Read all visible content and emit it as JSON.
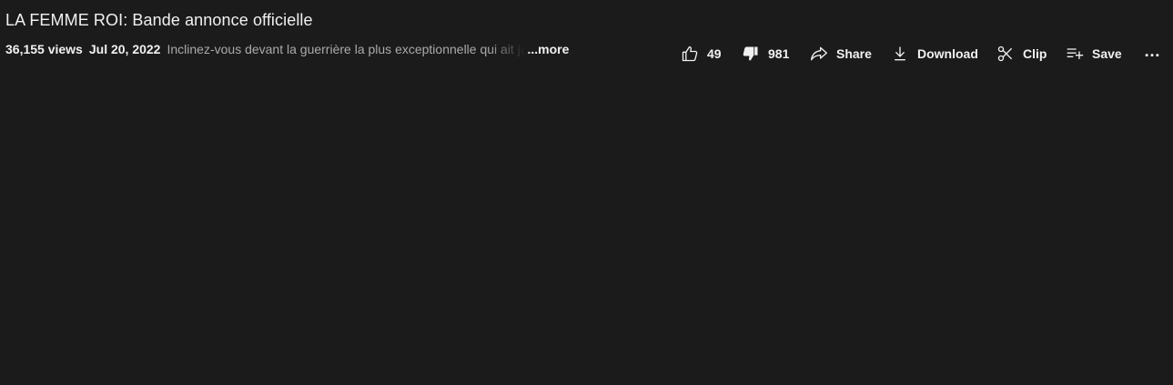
{
  "video": {
    "title": "LA FEMME ROI: Bande annonce officielle",
    "views": "36,155 views",
    "date": "Jul 20, 2022",
    "description_snippet": "Inclinez-vous devant la guerrière la plus exceptionnelle qui ait jamais",
    "more_label": "...more"
  },
  "actions": {
    "like_count": "49",
    "dislike_count": "981",
    "share_label": "Share",
    "download_label": "Download",
    "clip_label": "Clip",
    "save_label": "Save"
  },
  "icons": {
    "like": "thumbs-up-icon",
    "dislike": "thumbs-down-icon",
    "share": "share-arrow-icon",
    "download": "download-icon",
    "clip": "scissors-icon",
    "save": "playlist-add-icon",
    "more": "more-horizontal-icon"
  },
  "colors": {
    "background": "#1b1b1b",
    "text_primary": "#f1f1f1",
    "text_secondary": "#aaaaaa"
  }
}
